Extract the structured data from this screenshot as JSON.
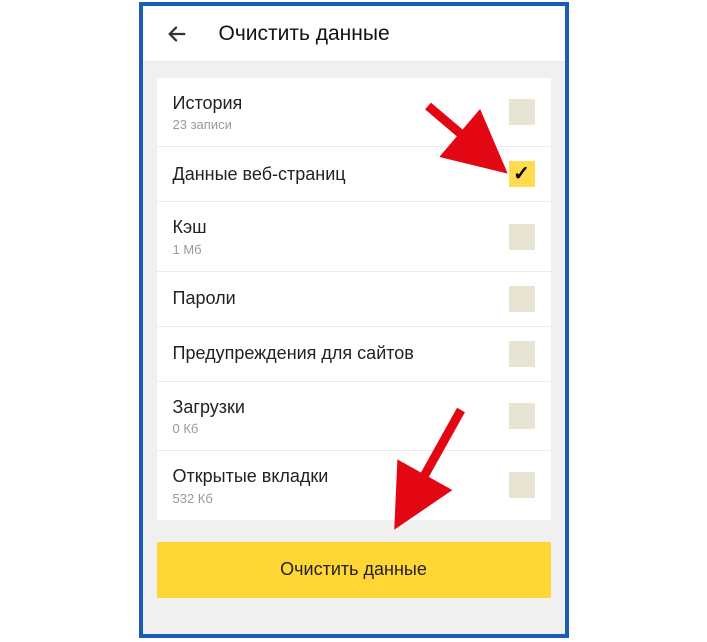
{
  "header": {
    "title": "Очистить данные"
  },
  "items": [
    {
      "label": "История",
      "sub": "23 записи",
      "checked": false
    },
    {
      "label": "Данные веб-страниц",
      "sub": "",
      "checked": true
    },
    {
      "label": "Кэш",
      "sub": "1 Мб",
      "checked": false
    },
    {
      "label": "Пароли",
      "sub": "",
      "checked": false
    },
    {
      "label": "Предупреждения для сайтов",
      "sub": "",
      "checked": false
    },
    {
      "label": "Загрузки",
      "sub": "0 Кб",
      "checked": false
    },
    {
      "label": "Открытые вкладки",
      "sub": "532 Кб",
      "checked": false
    }
  ],
  "action": {
    "label": "Очистить данные"
  },
  "colors": {
    "accent": "#ffd633",
    "checkbox_checked": "#ffdb4d",
    "frame_border": "#1a5db8",
    "arrow": "#e30613"
  }
}
